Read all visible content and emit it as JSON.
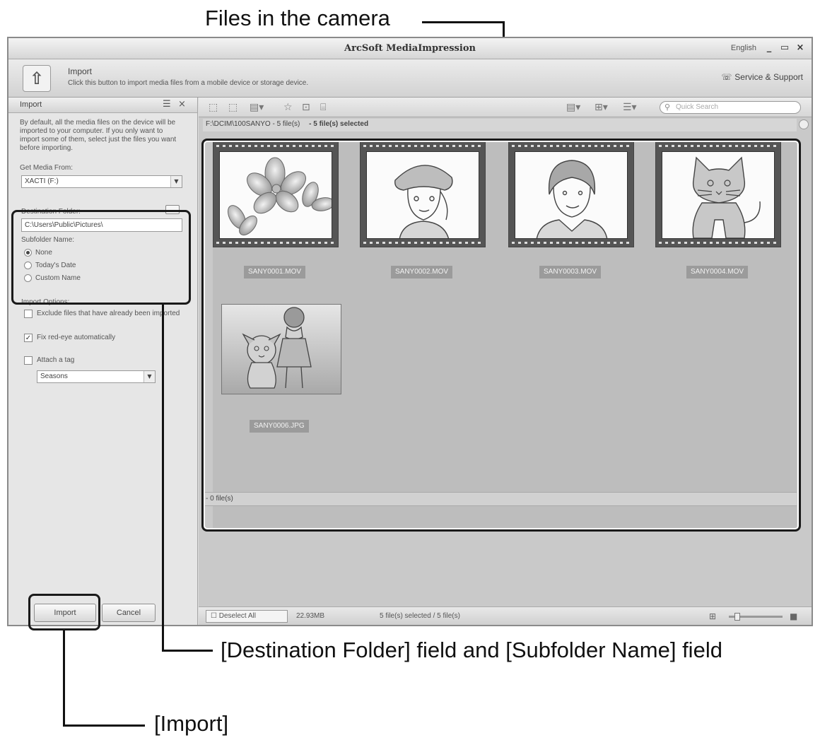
{
  "callouts": {
    "files_in_camera": "Files in the camera",
    "destination_subfolder": "[Destination Folder] field and [Subfolder Name] field",
    "import": "[Import]"
  },
  "window": {
    "title": "ArcSoft MediaImpression",
    "language": "English",
    "min_glyph": "_",
    "restore_glyph": "▭",
    "close_glyph": "×"
  },
  "mode": {
    "title": "Import",
    "description": "Click this button to import media files from a mobile device or storage device.",
    "support_label": "Service & Support",
    "icon_glyph": "⇧",
    "support_glyph": "☏"
  },
  "left_panel": {
    "header": "Import",
    "header_icons": [
      "☰",
      "×"
    ],
    "intro": "By default, all the media files on the device will be imported to your computer. If you only want to import some of them, select just the files you want before importing.",
    "get_media_label": "Get Media From:",
    "get_media_value": "XACTI (F:)",
    "destination_label": "Destination Folder:",
    "destination_value": "C:\\Users\\Public\\Pictures\\",
    "subfolder_label": "Subfolder Name:",
    "subfolder_options": [
      {
        "label": "None",
        "selected": true
      },
      {
        "label": "Today's Date",
        "selected": false
      },
      {
        "label": "Custom Name",
        "selected": false
      }
    ],
    "import_options_label": "Import Options:",
    "options": [
      {
        "label": "Exclude files that have already been imported",
        "checked": false
      },
      {
        "label": "Fix red-eye automatically",
        "checked": true
      }
    ],
    "attach_tag_label": "Attach a tag",
    "attach_tag_checked": false,
    "tag_value": "Seasons",
    "import_button": "Import",
    "cancel_button": "Cancel"
  },
  "toolbar": {
    "icons_left": [
      "⬚",
      "⬚",
      "▤▾",
      "☆",
      "⊡",
      "⌸"
    ],
    "icons_right": [
      "▤▾",
      "⊞▾",
      "☰▾"
    ],
    "search_placeholder": "Quick Search",
    "search_glyph": "⚲"
  },
  "content": {
    "group1_path": "F:\\DCIM\\100SANYO - 5 file(s)",
    "group1_selected": "- 5 file(s) selected",
    "group2_label": "- 0 file(s)",
    "thumbnails": [
      {
        "name": "SANY0001.MOV",
        "type": "video",
        "subject": "flower"
      },
      {
        "name": "SANY0002.MOV",
        "type": "video",
        "subject": "girl-hat"
      },
      {
        "name": "SANY0003.MOV",
        "type": "video",
        "subject": "woman"
      },
      {
        "name": "SANY0004.MOV",
        "type": "video",
        "subject": "cat"
      },
      {
        "name": "SANY0006.JPG",
        "type": "photo",
        "subject": "girl-dog"
      }
    ]
  },
  "statusbar": {
    "deselect_label": "Deselect All",
    "deselect_glyph": "☐",
    "size": "22.93MB",
    "selection": "5 file(s) selected / 5 file(s)",
    "view_glyph_small": "⊞",
    "view_glyph_large": "■"
  },
  "colors": {
    "callout_line": "#111111",
    "window_bg": "#dcdcdc",
    "content_bg": "#c9c9c9",
    "filename_label": "#9b9b9b"
  }
}
